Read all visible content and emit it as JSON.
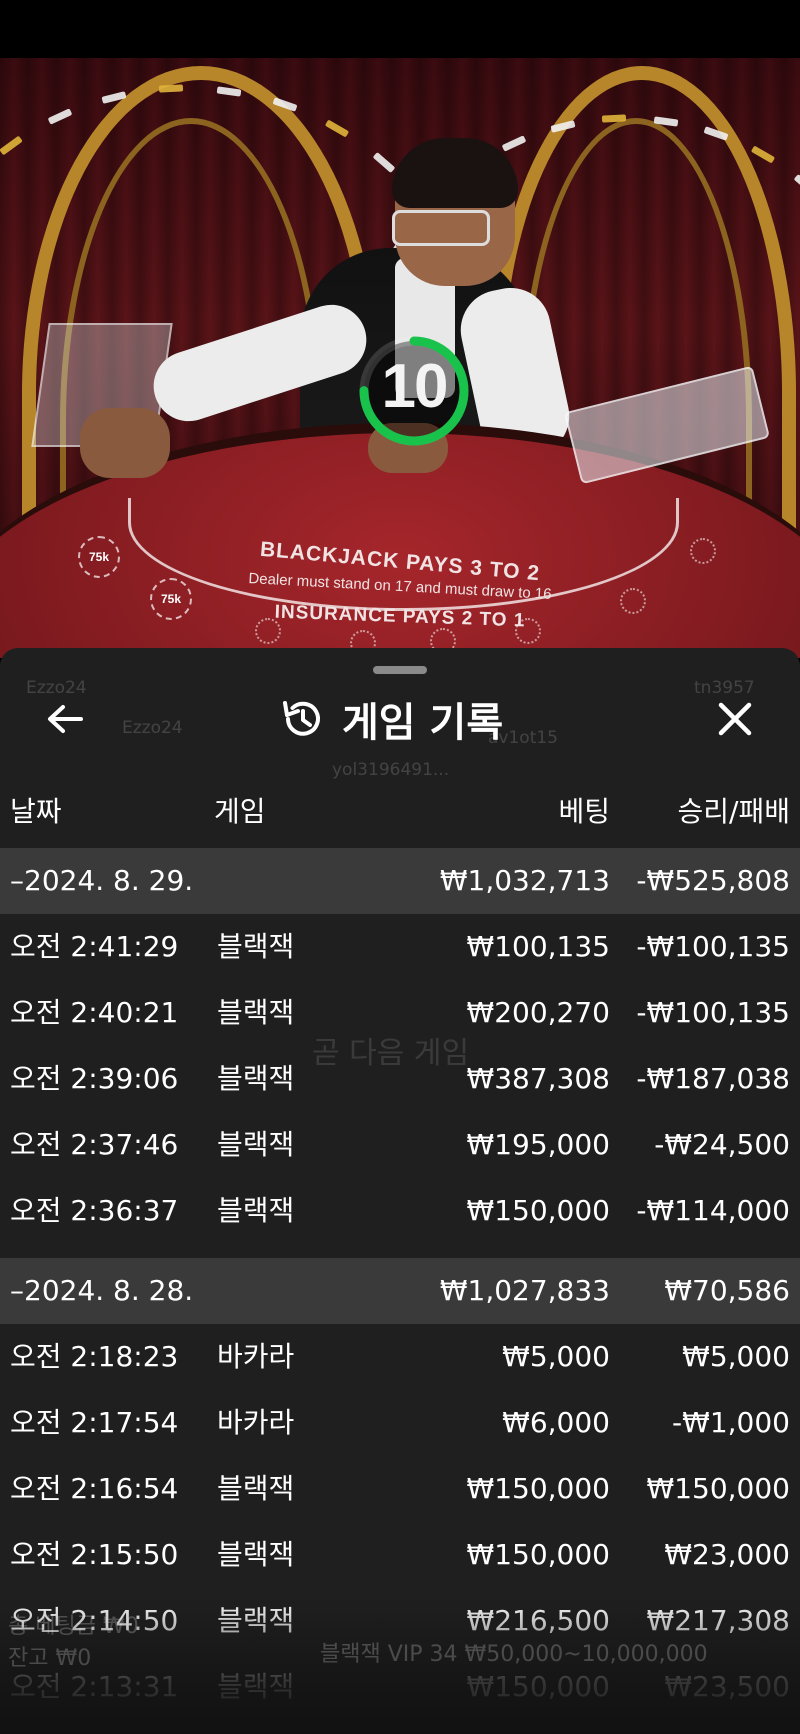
{
  "video": {
    "countdown": "10",
    "countdown_progress": 0.75,
    "felt": {
      "line1": "BLACKJACK PAYS 3 TO 2",
      "line2": "Dealer must stand on 17 and must draw to 16",
      "line3": "INSURANCE PAYS 2 TO 1"
    },
    "chips": [
      "75k",
      "75k"
    ]
  },
  "ghost": {
    "player1": "Ezzo24",
    "player2": "Ezzo24",
    "player3": "yol3196491...",
    "player4": "av1ot15",
    "player5": "tn3957",
    "next_game": "곧 다음 게임",
    "balance_label": "총 베팅금 ₩0",
    "balance2": "잔고 ₩0",
    "table_name": "블랙잭 VIP 34 ₩50,000~10,000,000"
  },
  "header": {
    "title": "게임 기록",
    "back_icon": "arrow-left-icon",
    "history_icon": "history-clock-icon",
    "close_icon": "close-x-icon"
  },
  "columns": {
    "date": "날짜",
    "game": "게임",
    "bet": "베팅",
    "result": "승리/패배"
  },
  "groups": [
    {
      "date": "–2024. 8. 29.",
      "bet": "₩1,032,713",
      "result": "-₩525,808",
      "rows": [
        {
          "time": "오전 2:41:29",
          "game": "블랙잭",
          "bet": "₩100,135",
          "result": "-₩100,135"
        },
        {
          "time": "오전 2:40:21",
          "game": "블랙잭",
          "bet": "₩200,270",
          "result": "-₩100,135"
        },
        {
          "time": "오전 2:39:06",
          "game": "블랙잭",
          "bet": "₩387,308",
          "result": "-₩187,038"
        },
        {
          "time": "오전 2:37:46",
          "game": "블랙잭",
          "bet": "₩195,000",
          "result": "-₩24,500"
        },
        {
          "time": "오전 2:36:37",
          "game": "블랙잭",
          "bet": "₩150,000",
          "result": "-₩114,000"
        }
      ]
    },
    {
      "date": "–2024. 8. 28.",
      "bet": "₩1,027,833",
      "result": "₩70,586",
      "rows": [
        {
          "time": "오전 2:18:23",
          "game": "바카라",
          "bet": "₩5,000",
          "result": "₩5,000"
        },
        {
          "time": "오전 2:17:54",
          "game": "바카라",
          "bet": "₩6,000",
          "result": "-₩1,000"
        },
        {
          "time": "오전 2:16:54",
          "game": "블랙잭",
          "bet": "₩150,000",
          "result": "₩150,000"
        },
        {
          "time": "오전 2:15:50",
          "game": "블랙잭",
          "bet": "₩150,000",
          "result": "₩23,000"
        },
        {
          "time": "오전 2:14:50",
          "game": "블랙잭",
          "bet": "₩216,500",
          "result": "₩217,308"
        },
        {
          "time": "오전 2:13:31",
          "game": "블랙잭",
          "bet": "₩150,000",
          "result": "₩23,500"
        }
      ]
    }
  ]
}
